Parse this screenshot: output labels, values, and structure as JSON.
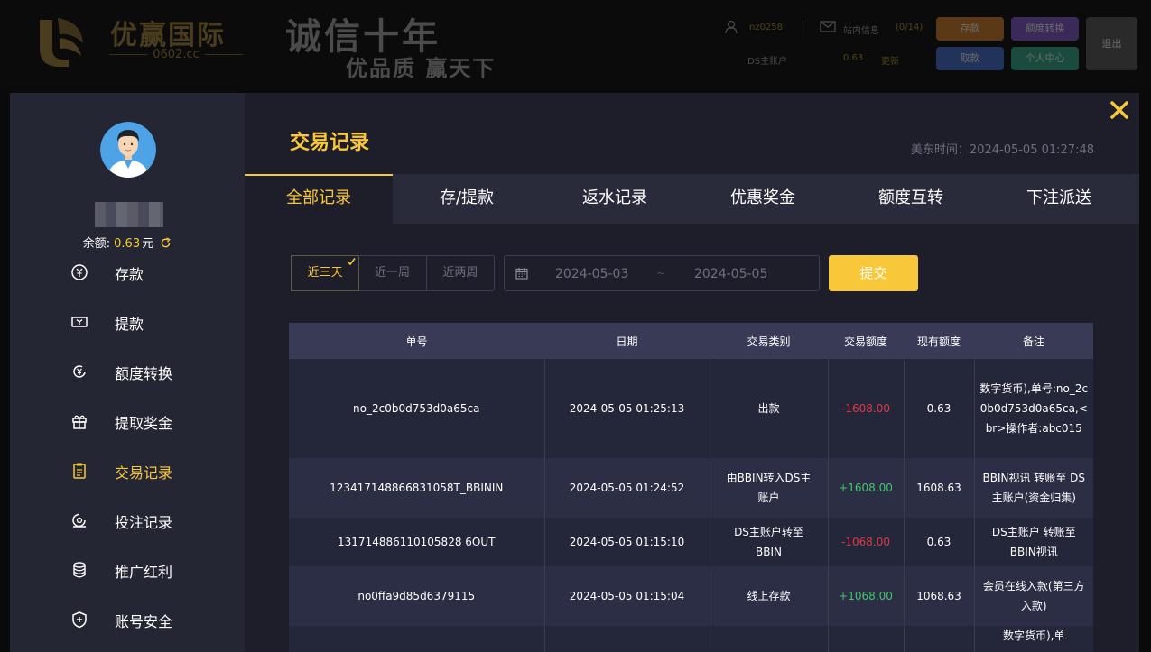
{
  "header": {
    "logo_name": "优赢国际",
    "logo_url": "0602.cc",
    "slogan_main": "诚信十年",
    "slogan_sub": "优品质 赢天下",
    "username": "nz0258",
    "messages_label": "站内信息",
    "messages_count": "(0/14)",
    "account_label": "DS主账户",
    "account_balance": "0.63",
    "refresh_label": "更新",
    "deposit_btn": "存款",
    "transfer_btn": "额度转换",
    "withdraw_btn": "取款",
    "center_btn": "个人中心",
    "logout_btn": "退出"
  },
  "sidebar": {
    "balance_label": "余额:",
    "balance_value": "0.63",
    "balance_unit": "元",
    "menu": [
      {
        "label": "存款",
        "icon": "deposit-icon"
      },
      {
        "label": "提款",
        "icon": "withdraw-icon"
      },
      {
        "label": "额度转换",
        "icon": "transfer-icon"
      },
      {
        "label": "提取奖金",
        "icon": "gift-icon"
      },
      {
        "label": "交易记录",
        "icon": "clipboard-icon",
        "active": true
      },
      {
        "label": "投注记录",
        "icon": "bet-record-icon"
      },
      {
        "label": "推广红利",
        "icon": "coins-icon"
      },
      {
        "label": "账号安全",
        "icon": "shield-icon"
      }
    ]
  },
  "main": {
    "title": "交易记录",
    "time": "美东时间：2024-05-05 01:27:48",
    "tabs": [
      "全部记录",
      "存/提款",
      "返水记录",
      "优惠奖金",
      "额度互转",
      "下注派送"
    ],
    "filters": [
      "近三天",
      "近一周",
      "近两周"
    ],
    "date_from": "2024-05-03",
    "date_sep": "~",
    "date_to": "2024-05-05",
    "submit": "提交"
  },
  "table": {
    "headers": [
      "单号",
      "日期",
      "交易类别",
      "交易额度",
      "现有额度",
      "备注"
    ],
    "rows": [
      {
        "id": "no_2c0b0d753d0a65ca",
        "date": "2024-05-05 01:25:13",
        "type": "出款",
        "amount": "-1608.00",
        "balance": "0.63",
        "note": "数字货币),单号:no_2c0b0d753d0a65ca,<br>操作者:abc015"
      },
      {
        "id": "123417148866831058T_BBININ",
        "date": "2024-05-05 01:24:52",
        "type": "由BBIN转入DS主账户",
        "amount": "+1608.00",
        "balance": "1608.63",
        "note": "BBIN视讯 转账至 DS主账户(资金归集)"
      },
      {
        "id": "131714886110105828 6OUT",
        "date": "2024-05-05 01:15:10",
        "type": "DS主账户转至BBIN",
        "amount": "-1068.00",
        "balance": "0.63",
        "note": "DS主账户 转账至 BBIN视讯"
      },
      {
        "id": "no0ffa9d85d6379115",
        "date": "2024-05-05 01:15:04",
        "type": "线上存款",
        "amount": "+1068.00",
        "balance": "1068.63",
        "note": "会员在线入款(第三方入款)"
      },
      {
        "id": "",
        "date": "",
        "type": "",
        "amount": "",
        "balance": "",
        "note": "数字货币),单"
      }
    ]
  },
  "colors": {
    "accent": "#f8c73a",
    "negative": "#e0384a",
    "positive": "#42c66a"
  }
}
